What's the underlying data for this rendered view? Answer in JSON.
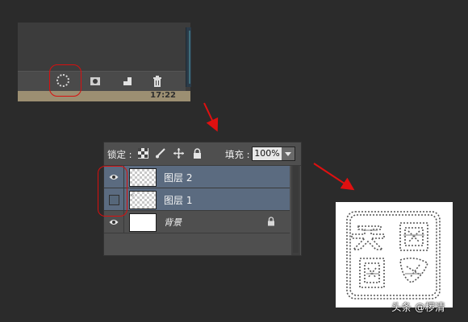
{
  "top_crop": {
    "toolbar_icons": [
      "selection-dashed-circle-icon",
      "mask-icon",
      "new-channel-icon",
      "trash-icon"
    ],
    "status_text": "17:22"
  },
  "layers_panel": {
    "lock_label": "锁定 :",
    "lock_icons": [
      "lock-transparent-icon",
      "lock-brush-icon",
      "lock-move-icon",
      "lock-all-icon"
    ],
    "fill_label": "填充 :",
    "fill_value": "100%",
    "layers": [
      {
        "name": "图层 2",
        "visible": true,
        "selected": true,
        "thumb": "transparent"
      },
      {
        "name": "图层 1",
        "visible": false,
        "selected": true,
        "thumb": "transparent"
      },
      {
        "name": "背景",
        "visible": true,
        "selected": false,
        "thumb": "white",
        "locked": true
      }
    ]
  },
  "result_image": {
    "watermark": "头条 @椤清"
  },
  "colors": {
    "background": "#2b2b2b",
    "panel": "#4f4f4f",
    "selected_row": "#5b6b80",
    "highlight": "#d80f0f",
    "arrow": "#e01010"
  }
}
